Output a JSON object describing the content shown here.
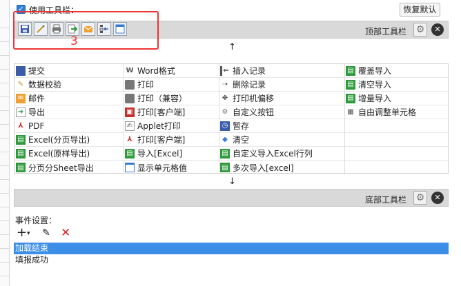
{
  "header": {
    "use_toolbar_label": "使用工具栏：",
    "restore_default_label": "恢复默认"
  },
  "top_toolbar": {
    "label": "顶部工具栏",
    "buttons": [
      "save-icon",
      "verify-icon",
      "print-icon",
      "export-icon",
      "mail-icon",
      "insert-row-icon",
      "cell-icon"
    ]
  },
  "annotation": {
    "number": "3",
    "color": "#e33333"
  },
  "arrows": {
    "up": "↑",
    "down": "↓"
  },
  "items": [
    [
      "提交",
      "Word格式",
      "插入记录",
      "覆盖导入"
    ],
    [
      "数据校验",
      "打印",
      "删除记录",
      "清空导入"
    ],
    [
      "邮件",
      "打印（兼容）",
      "打印机偏移",
      "增量导入"
    ],
    [
      "导出",
      "打印[客户端]",
      "自定义按钮",
      "自由调整单元格"
    ],
    [
      "PDF",
      "Applet打印",
      "暂存",
      ""
    ],
    [
      "Excel(分页导出)",
      "打印[客户端]",
      "清空",
      ""
    ],
    [
      "Excel(原样导出)",
      "导入[Excel]",
      "自定义导入Excel行列",
      ""
    ],
    [
      "分页分Sheet导出",
      "显示单元格值",
      "多次导入[excel]",
      ""
    ]
  ],
  "bottom_toolbar": {
    "label": "底部工具栏"
  },
  "events": {
    "label": "事件设置：",
    "list": [
      "加载结束",
      "填报成功"
    ],
    "selected_index": 0
  },
  "colors": {
    "accent": "#3c8ee8",
    "bar": "#d9d9d9",
    "highlight": "#e33333"
  }
}
